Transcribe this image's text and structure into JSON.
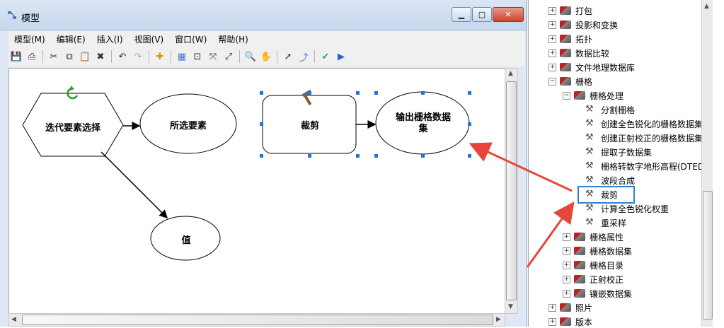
{
  "window": {
    "title": "模型"
  },
  "menu": [
    "模型(M)",
    "编辑(E)",
    "插入(I)",
    "视图(V)",
    "窗口(W)",
    "帮助(H)"
  ],
  "diagram": {
    "nodes": {
      "iterate": "迭代要素选择",
      "selected": "所选要素",
      "clip": "裁剪",
      "output": "输出栅格数据集",
      "value": "值"
    }
  },
  "tree": {
    "items": [
      {
        "label": "打包",
        "level": 1,
        "expander": "+",
        "icon": "toolbox-icon"
      },
      {
        "label": "投影和变换",
        "level": 1,
        "expander": "+",
        "icon": "toolbox-icon"
      },
      {
        "label": "拓扑",
        "level": 1,
        "expander": "+",
        "icon": "toolbox-icon"
      },
      {
        "label": "数据比较",
        "level": 1,
        "expander": "+",
        "icon": "toolbox-icon"
      },
      {
        "label": "文件地理数据库",
        "level": 1,
        "expander": "+",
        "icon": "toolbox-icon"
      },
      {
        "label": "栅格",
        "level": 1,
        "expander": "−",
        "icon": "toolbox-icon"
      },
      {
        "label": "栅格处理",
        "level": 2,
        "expander": "−",
        "icon": "toolbox-icon"
      },
      {
        "label": "分割栅格",
        "level": 3,
        "icon": "hammer-icon"
      },
      {
        "label": "创建全色锐化的栅格数据集",
        "level": 3,
        "icon": "hammer-icon"
      },
      {
        "label": "创建正射校正的栅格数据集",
        "level": 3,
        "icon": "hammer-icon"
      },
      {
        "label": "提取子数据集",
        "level": 3,
        "icon": "hammer-icon"
      },
      {
        "label": "栅格转数字地形高程(DTED)",
        "level": 3,
        "icon": "hammer-icon"
      },
      {
        "label": "波段合成",
        "level": 3,
        "icon": "hammer-icon"
      },
      {
        "label": "裁剪",
        "level": 3,
        "icon": "hammer-icon"
      },
      {
        "label": "计算全色锐化权重",
        "level": 3,
        "icon": "hammer-icon"
      },
      {
        "label": "重采样",
        "level": 3,
        "icon": "hammer-icon"
      },
      {
        "label": "栅格属性",
        "level": 2,
        "expander": "+",
        "icon": "toolbox-icon"
      },
      {
        "label": "栅格数据集",
        "level": 2,
        "expander": "+",
        "icon": "toolbox-icon"
      },
      {
        "label": "栅格目录",
        "level": 2,
        "expander": "+",
        "icon": "toolbox-icon"
      },
      {
        "label": "正射校正",
        "level": 2,
        "expander": "+",
        "icon": "toolbox-icon"
      },
      {
        "label": "镶嵌数据集",
        "level": 2,
        "expander": "+",
        "icon": "toolbox-icon"
      },
      {
        "label": "照片",
        "level": 1,
        "expander": "+",
        "icon": "toolbox-icon"
      },
      {
        "label": "版本",
        "level": 1,
        "expander": "+",
        "icon": "toolbox-icon"
      }
    ]
  },
  "annotation": {
    "highlight_color": "#2b83d1",
    "arrow_color": "#e8453c"
  }
}
